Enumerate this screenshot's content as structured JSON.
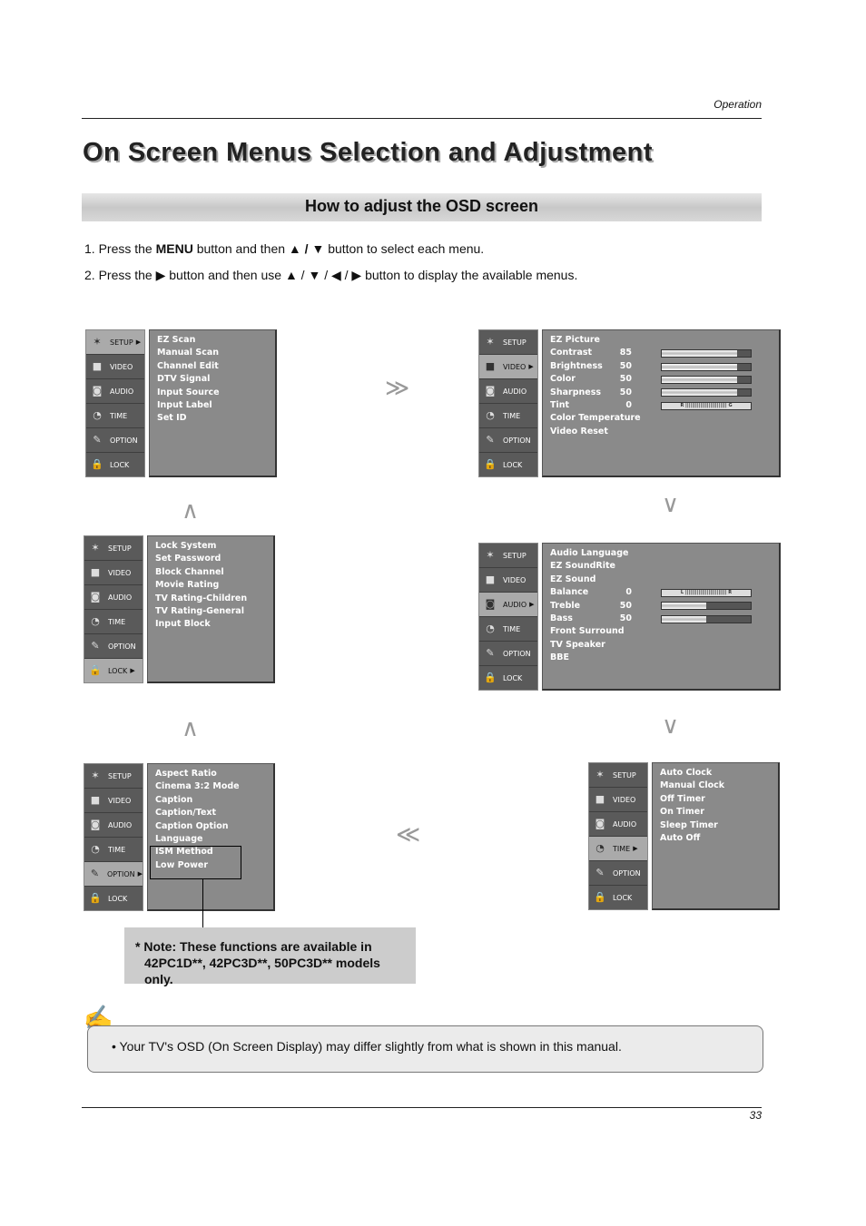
{
  "header": {
    "section": "Operation",
    "page_number": "33"
  },
  "title": "On Screen Menus Selection and Adjustment",
  "subheading": "How to adjust the OSD screen",
  "steps": [
    {
      "prefix": "1. Press the ",
      "bold": "MENU",
      "mid": " button and then ",
      "keys": "▲ / ▼",
      "suffix": " button to select each menu."
    },
    {
      "prefix": "2. Press the ",
      "key1": "▶",
      "mid": " button and then use ",
      "keys": "▲ / ▼ / ◀ / ▶",
      "suffix": " button to display the available menus."
    }
  ],
  "sidebar_labels": {
    "setup": "SETUP",
    "video": "VIDEO",
    "audio": "AUDIO",
    "time": "TIME",
    "option": "OPTION",
    "lock": "LOCK"
  },
  "menus": {
    "setup": {
      "items": [
        "EZ Scan",
        "Manual Scan",
        "Channel Edit",
        "DTV Signal",
        "Input Source",
        "Input Label",
        "Set ID"
      ]
    },
    "video": {
      "items": [
        {
          "label": "EZ Picture"
        },
        {
          "label": "Contrast",
          "value": "85",
          "level": 0.85
        },
        {
          "label": "Brightness",
          "value": "50",
          "level": 0.85
        },
        {
          "label": "Color",
          "value": "50",
          "level": 0.85
        },
        {
          "label": "Sharpness",
          "value": "50",
          "level": 0.85
        },
        {
          "label": "Tint",
          "value": "0",
          "scale": "R ||||||||||||||||||||||||| G"
        },
        {
          "label": "Color Temperature"
        },
        {
          "label": "Video Reset"
        }
      ]
    },
    "audio": {
      "items": [
        {
          "label": "Audio Language"
        },
        {
          "label": "EZ SoundRite"
        },
        {
          "label": "EZ Sound"
        },
        {
          "label": "Balance",
          "value": "0",
          "scale": "L ||||||||||||||||||||||||| R"
        },
        {
          "label": "Treble",
          "value": "50",
          "level": 0.5
        },
        {
          "label": "Bass",
          "value": "50",
          "level": 0.5
        },
        {
          "label": "Front Surround"
        },
        {
          "label": "TV Speaker"
        },
        {
          "label": "BBE"
        }
      ]
    },
    "time": {
      "items": [
        "Auto Clock",
        "Manual Clock",
        "Off Timer",
        "On Timer",
        "Sleep Timer",
        "Auto Off"
      ]
    },
    "option": {
      "items": [
        "Aspect Ratio",
        "Cinema 3:2 Mode",
        "Caption",
        "Caption/Text",
        "Caption Option",
        "Language",
        "ISM Method",
        "Low Power"
      ]
    },
    "lock": {
      "items": [
        "Lock System",
        "Set Password",
        "Block Channel",
        "Movie Rating",
        "TV Rating-Children",
        "TV Rating-General",
        "Input Block"
      ]
    }
  },
  "note": {
    "line1": "* Note: These functions are available in",
    "line2": "42PC1D**, 42PC3D**, 50PC3D** models only."
  },
  "tip": "• Your TV's OSD (On Screen Display) may differ slightly from what is shown in this manual.",
  "icons": {
    "next_right": "≫",
    "next_down": "∨",
    "next_left": "≪",
    "next_up": "∧"
  }
}
